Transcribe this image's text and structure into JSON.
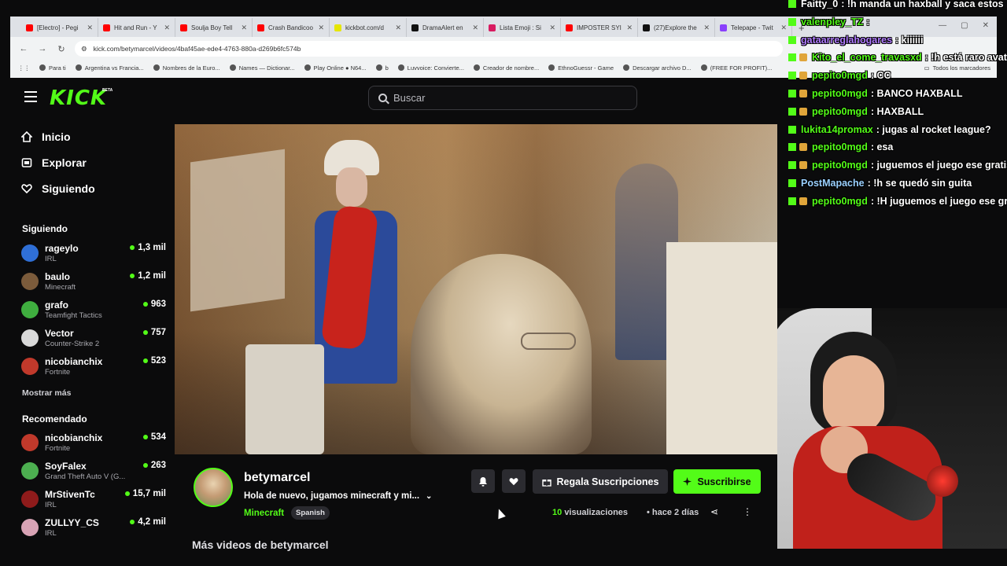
{
  "browser": {
    "tabs": [
      {
        "title": "[Electro] - Pegi",
        "color": "#ff0000",
        "active": false
      },
      {
        "title": "Hit and Run - Y",
        "color": "#ff0000",
        "active": false
      },
      {
        "title": "Soulja Boy Tell",
        "color": "#ff0000",
        "active": false
      },
      {
        "title": "Crash Bandicoo",
        "color": "#ff0000",
        "active": false
      },
      {
        "title": "kickbot.com/d",
        "color": "#e6e600",
        "active": false
      },
      {
        "title": "DramaAlert en",
        "color": "#111111",
        "active": false
      },
      {
        "title": "Lista Emoji : Si",
        "color": "#d81b60",
        "active": false
      },
      {
        "title": "IMPOSTER SYI",
        "color": "#ff0000",
        "active": false
      },
      {
        "title": "(27)Explore the",
        "color": "#111111",
        "active": false
      },
      {
        "title": "Telepape - Twit",
        "color": "#8a3ffc",
        "active": false
      }
    ],
    "new_tab": "+",
    "url": "kick.com/betymarcel/videos/4baf45ae-ede4-4763-880a-d269b6fc574b",
    "bookmarks": [
      "Para ti",
      "Argentina vs Francia...",
      "Nombres de la Euro...",
      "Names — Dictionar...",
      "Play Online ● N64...",
      "b",
      "Luvvoice: Convierte...",
      "Creador de nombre...",
      "EthnoGuessr - Game",
      "Descargar archivo D...",
      "(FREE FOR PROFIT)..."
    ],
    "all_bookmarks": "Todos los marcadores"
  },
  "header": {
    "logo": "KICK",
    "logo_badge": "BETA",
    "search_placeholder": "Buscar"
  },
  "sidebar": {
    "nav": [
      {
        "label": "Inicio",
        "icon": "home-icon"
      },
      {
        "label": "Explorar",
        "icon": "compass-icon"
      },
      {
        "label": "Siguiendo",
        "icon": "heart-icon"
      }
    ],
    "following_title": "Siguiendo",
    "following": [
      {
        "name": "rageylo",
        "category": "IRL",
        "viewers": "1,3 mil",
        "color": "#2f6fd6"
      },
      {
        "name": "baulo",
        "category": "Minecraft",
        "viewers": "1,2 mil",
        "color": "#7b5b3b"
      },
      {
        "name": "grafo",
        "category": "Teamfight Tactics",
        "viewers": "963",
        "color": "#3fae3f"
      },
      {
        "name": "Vector",
        "category": "Counter-Strike 2",
        "viewers": "757",
        "color": "#d9d9d9"
      },
      {
        "name": "nicobianchix",
        "category": "Fortnite",
        "viewers": "523",
        "color": "#c0392b"
      }
    ],
    "show_more": "Mostrar más",
    "recommended_title": "Recomendado",
    "recommended": [
      {
        "name": "nicobianchix",
        "category": "Fortnite",
        "viewers": "534",
        "color": "#c0392b"
      },
      {
        "name": "SoyFalex",
        "category": "Grand Theft Auto V (G...",
        "viewers": "263",
        "color": "#4caf50"
      },
      {
        "name": "MrStivenTc",
        "category": "IRL",
        "viewers": "15,7 mil",
        "color": "#8e1b1b"
      },
      {
        "name": "ZULLYY_CS",
        "category": "IRL",
        "viewers": "4,2 mil",
        "color": "#d8a3b5"
      }
    ]
  },
  "video_info": {
    "streamer": "betymarcel",
    "title": "Hola de nuevo, jugamos minecraft y mi...",
    "category": "Minecraft",
    "language": "Spanish",
    "gift_label": "Regala Suscripciones",
    "subscribe_label": "Suscribirse",
    "views_count": "10",
    "views_label": "visualizaciones",
    "ago": "hace 2 días",
    "more_videos": "Más videos de betymarcel"
  },
  "chat": [
    {
      "user": "Faitty_0",
      "text": ": !h manda un haxball y saca estos",
      "color": "#ffffff",
      "badges": [
        "k"
      ]
    },
    {
      "user": "valenpley_TZ",
      "text": ":",
      "color": "#53fc18",
      "badges": [
        "k"
      ]
    },
    {
      "user": "gataarreglahogares",
      "text": ": kiiiiii",
      "color": "#b07bff",
      "badges": [
        "k"
      ]
    },
    {
      "user": "Kito_el_come_travasxd",
      "text": ": !h está raro avata",
      "color": "#53fc18",
      "badges": [
        "k",
        "c"
      ]
    },
    {
      "user": "pepito0mgd",
      "text": ": CC",
      "color": "#53fc18",
      "badges": [
        "k",
        "c"
      ]
    },
    {
      "user": "pepito0mgd",
      "text": ": BANCO HAXBALL",
      "color": "#53fc18",
      "badges": [
        "k",
        "c"
      ]
    },
    {
      "user": "pepito0mgd",
      "text": ": HAXBALL",
      "color": "#53fc18",
      "badges": [
        "k",
        "c"
      ]
    },
    {
      "user": "lukita14promax",
      "text": ": jugas al rocket league?",
      "color": "#53fc18",
      "badges": [
        "k"
      ]
    },
    {
      "user": "pepito0mgd",
      "text": ": esa",
      "color": "#53fc18",
      "badges": [
        "k",
        "c"
      ]
    },
    {
      "user": "pepito0mgd",
      "text": ": juguemos el juego ese gratis",
      "color": "#53fc18",
      "badges": [
        "k",
        "c"
      ]
    },
    {
      "user": "PostMapache",
      "text": ": !h se quedó sin guita",
      "color": "#9ad0ff",
      "badges": [
        "k"
      ]
    },
    {
      "user": "pepito0mgd",
      "text": ": !H juguemos el juego ese gra",
      "color": "#53fc18",
      "badges": [
        "k",
        "c"
      ]
    }
  ]
}
